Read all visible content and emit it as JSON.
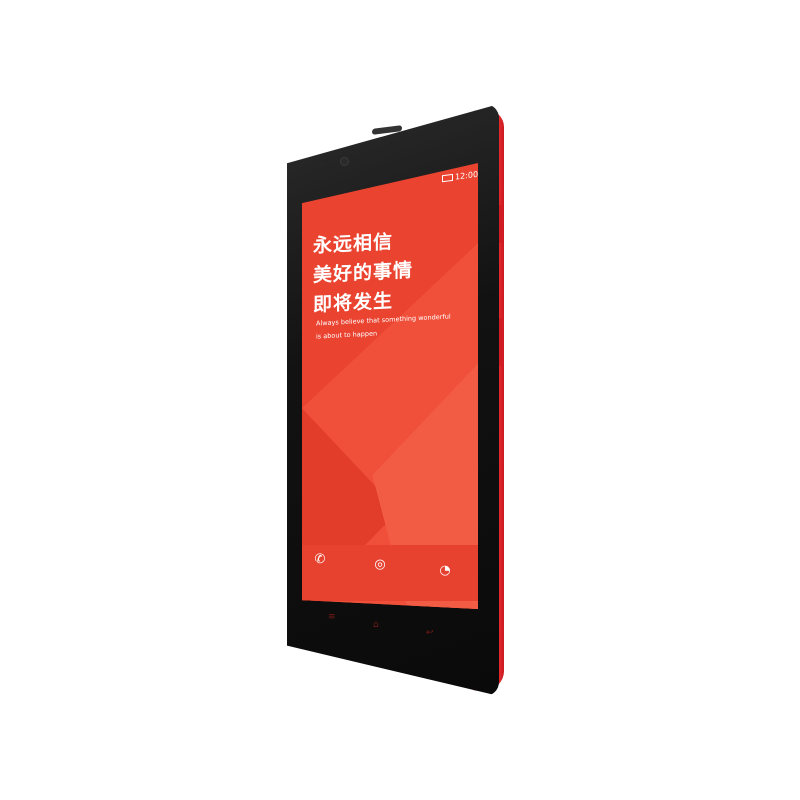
{
  "statusbar": {
    "time": "12:00"
  },
  "screen": {
    "headline": [
      "永远相信",
      "美好的事情",
      "即将发生"
    ],
    "subtitle": [
      "Always believe that something wonderful",
      "is about to happen"
    ]
  },
  "dock": {
    "icons": [
      "phone-icon",
      "camera-icon",
      "message-icon"
    ],
    "glyphs": [
      "✆",
      "◎",
      "◔"
    ]
  },
  "nav_keys": {
    "glyphs": [
      "≡",
      "⌂",
      "↩"
    ]
  },
  "colors": {
    "screen": "#ea4330",
    "body_edge": "#e8242b",
    "bezel": "#121212"
  }
}
